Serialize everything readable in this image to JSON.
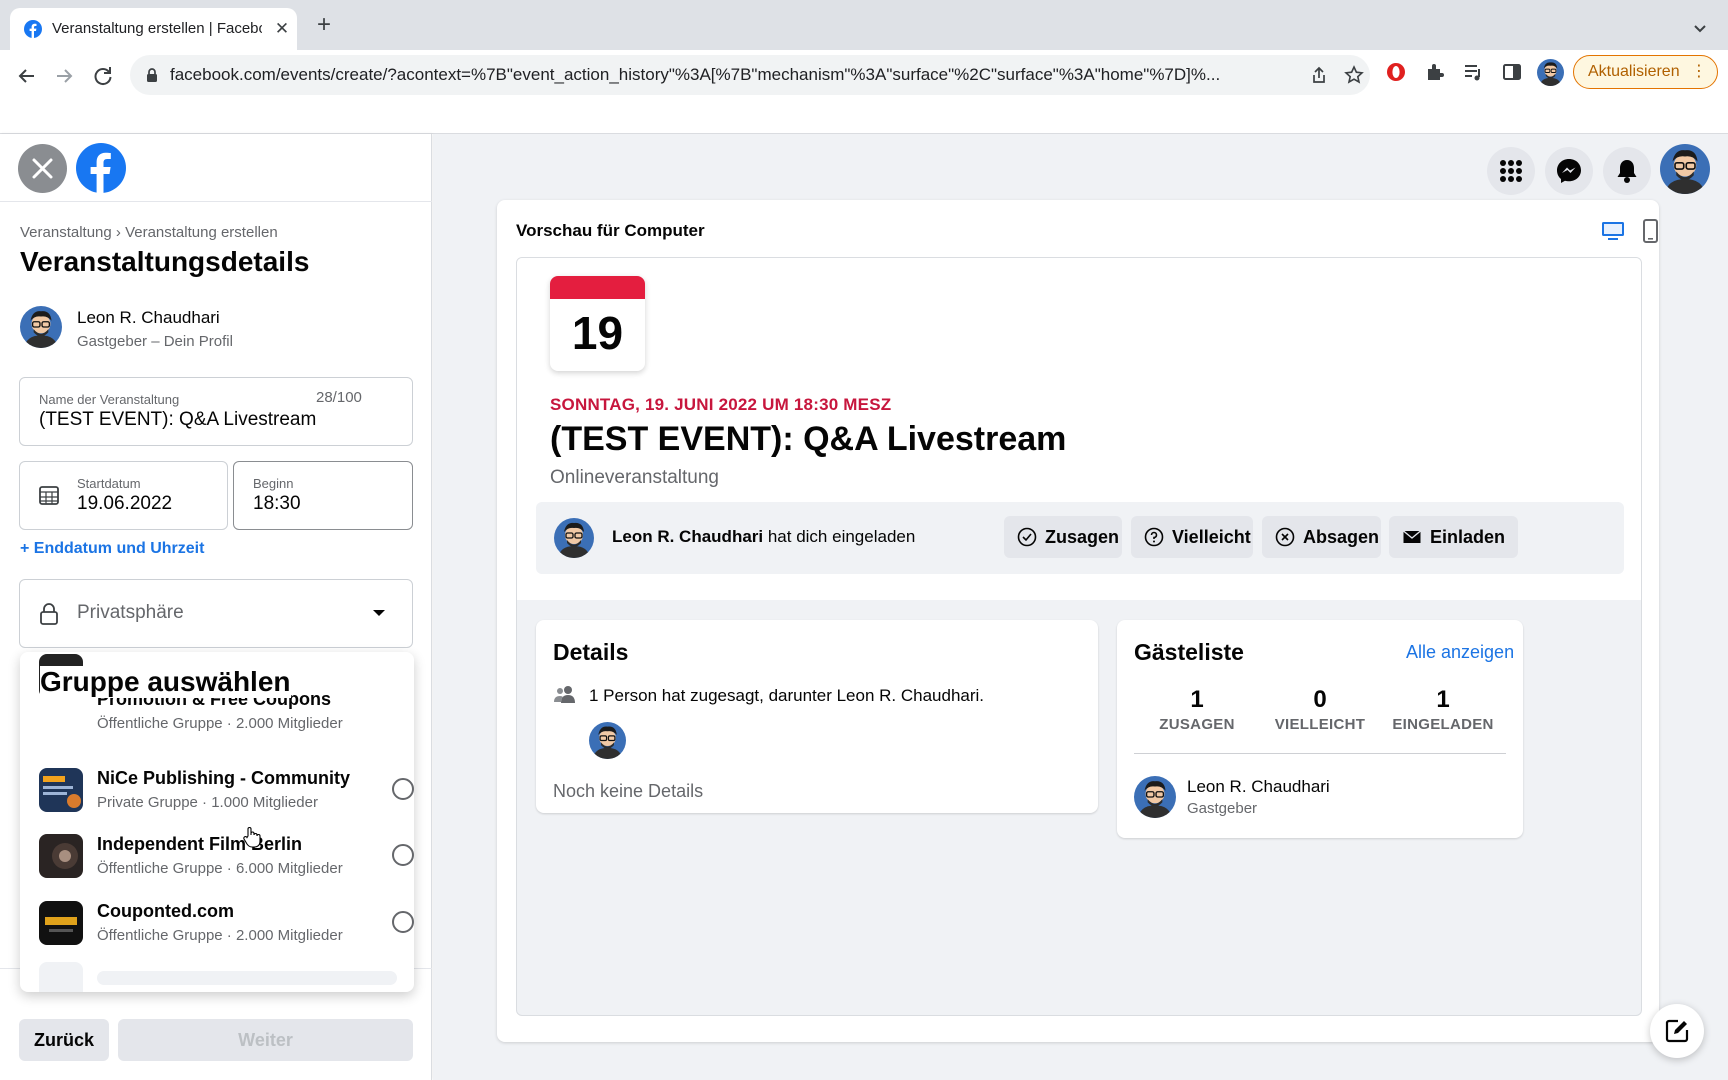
{
  "browser": {
    "tab_title": "Veranstaltung erstellen | Facebook",
    "url": "facebook.com/events/create/?acontext=%7B\"event_action_history\"%3A[%7B\"mechanism\"%3A\"surface\"%2C\"surface\"%3A\"home\"%7D]%...",
    "update_label": "Aktualisieren",
    "update_menu": "⋮",
    "accent": "#e37400"
  },
  "left": {
    "breadcrumb": "Veranstaltung › Veranstaltung erstellen",
    "title": "Veranstaltungsdetails",
    "host_name": "Leon R. Chaudhari",
    "host_sub": "Gastgeber – Dein Profil",
    "name_label": "Name der Veranstaltung",
    "name_value": "(TEST EVENT): Q&A Livestream",
    "name_count": "28/100",
    "start_label": "Startdatum",
    "start_value": "19.06.2022",
    "begin_label": "Beginn",
    "begin_value": "18:30",
    "end_link": "+ Enddatum und Uhrzeit",
    "privacy_label": "Privatsphäre",
    "dropdown_title": "Gruppe auswählen",
    "groups": [
      {
        "name": "Promotion & Free Coupons",
        "sub": "Öffentliche Gruppe · 2.000 Mitglieder"
      },
      {
        "name": "NiCe Publishing - Community",
        "sub": "Private Gruppe · 1.000 Mitglieder"
      },
      {
        "name": "Independent Film Berlin",
        "sub": "Öffentliche Gruppe · 6.000 Mitglieder"
      },
      {
        "name": "Couponted.com",
        "sub": "Öffentliche Gruppe · 2.000 Mitglieder"
      }
    ],
    "back_label": "Zurück",
    "next_label": "Weiter"
  },
  "preview": {
    "title": "Vorschau für Computer",
    "cal_day": "19",
    "date_line": "SONNTAG, 19. JUNI 2022 UM 18:30 MESZ",
    "event_title": "(TEST EVENT): Q&A Livestream",
    "event_type": "Onlineveranstaltung",
    "inviter": "Leon R. Chaudhari",
    "invite_text": " hat dich eingeladen",
    "btn_going": "Zusagen",
    "btn_maybe": "Vielleicht",
    "btn_decline": "Absagen",
    "btn_invite": "Einladen",
    "details_title": "Details",
    "details_line": "1 Person hat zugesagt, darunter Leon R. Chaudhari.",
    "details_none": "Noch keine Details",
    "guests_title": "Gästeliste",
    "guests_all": "Alle anzeigen",
    "stats": [
      {
        "n": "1",
        "label": "ZUSAGEN"
      },
      {
        "n": "0",
        "label": "VIELLEICHT"
      },
      {
        "n": "1",
        "label": "EINGELADEN"
      }
    ],
    "guest_name": "Leon R. Chaudhari",
    "guest_role": "Gastgeber",
    "date_color": "#c7163d",
    "link_color": "#1b74e4"
  }
}
